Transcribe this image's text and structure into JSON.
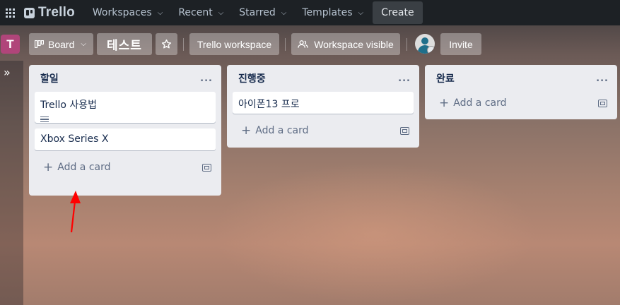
{
  "topnav": {
    "logo": "Trello",
    "menus": [
      "Workspaces",
      "Recent",
      "Starred",
      "Templates"
    ],
    "create_label": "Create"
  },
  "board_header": {
    "workspace_initial": "T",
    "view_label": "Board",
    "board_title": "테스트",
    "workspace_name": "Trello workspace",
    "visibility_label": "Workspace visible",
    "invite_label": "Invite"
  },
  "sidebar": {
    "toggle_icon": "double-chevron-right-icon"
  },
  "lists": [
    {
      "title": "할일",
      "menu": "...",
      "cards": [
        {
          "text": "Trello 사용법",
          "has_description": true
        },
        {
          "text": "Xbox Series X",
          "has_description": false
        }
      ],
      "add_card_label": "Add a card"
    },
    {
      "title": "진행중",
      "menu": "...",
      "cards": [
        {
          "text": "아이폰13 프로",
          "has_description": false
        }
      ],
      "add_card_label": "Add a card"
    },
    {
      "title": "완료",
      "menu": "...",
      "cards": [],
      "add_card_label": "Add a card"
    }
  ],
  "colors": {
    "topnav_bg": "#1d2125",
    "workspace_tile": "#b0457a",
    "list_bg": "#ebecf0",
    "annotation_arrow": "#ff0000"
  }
}
